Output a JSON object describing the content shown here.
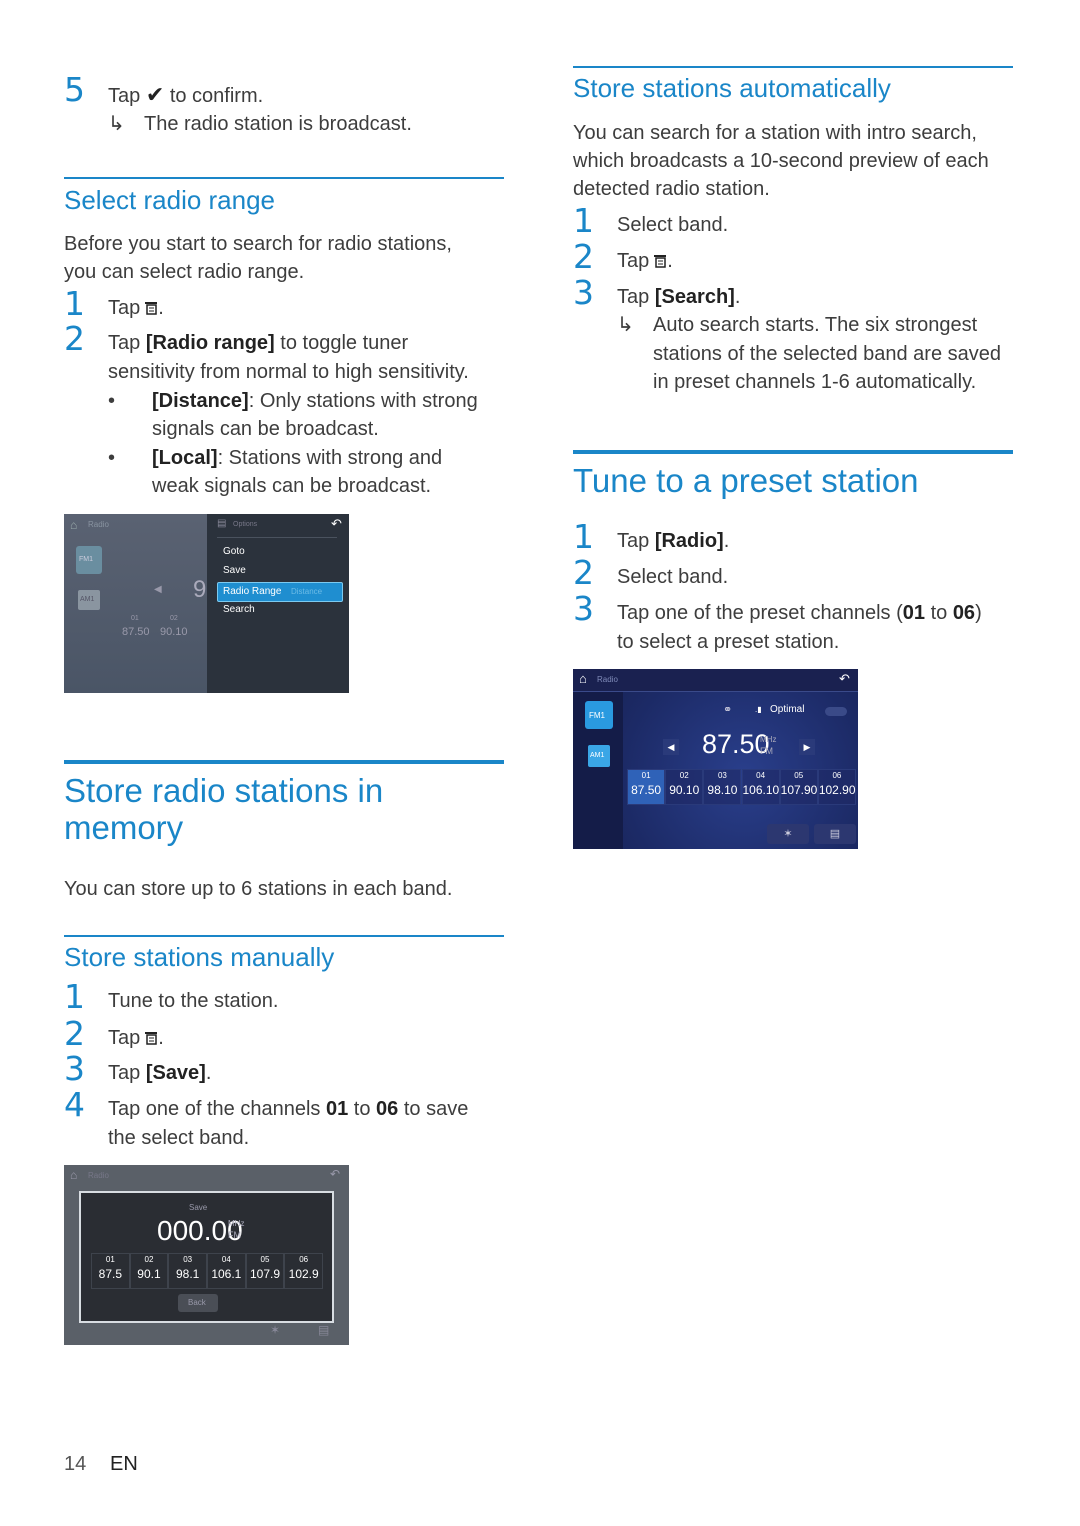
{
  "colors": {
    "accent": "#1a86c8",
    "text": "#3d3d3d"
  },
  "left": {
    "step5": {
      "num": "5",
      "tap": "Tap",
      "confirm": "to confirm.",
      "icon": "checkmark-icon",
      "result": "The radio station is broadcast."
    },
    "select_range": {
      "heading": "Select radio range",
      "intro": [
        "Before you start to search for radio stations,",
        "you can select radio range."
      ],
      "steps": [
        {
          "num": "1",
          "tap": "Tap",
          "end": ".",
          "icon": "menu-icon"
        },
        {
          "num": "2",
          "tap": "Tap",
          "bold": "[Radio range]",
          "rest": "to toggle tuner",
          "cont": "sensitivity from normal to high sensitivity."
        }
      ],
      "bullets": [
        {
          "bold": "[Distance]",
          "rest": ": Only stations with strong",
          "cont": "signals can be broadcast."
        },
        {
          "bold": "[Local]",
          "rest": ": Stations with strong and",
          "cont": "weak signals can be broadcast."
        }
      ],
      "screenshot": {
        "title": "Radio",
        "menu_title": "Options",
        "menu_items": [
          "Goto",
          "Save",
          "Radio Range",
          "Search"
        ],
        "selected_value": "Distance",
        "bands": [
          "FM1",
          "AM1"
        ],
        "presets": [
          {
            "n": "01",
            "v": "87.50"
          },
          {
            "n": "02",
            "v": "90.10"
          }
        ],
        "freq_partial": "9"
      }
    },
    "store_memory": {
      "heading_lines": [
        "Store radio stations in",
        "memory"
      ],
      "intro": "You can store up to 6 stations in each band."
    },
    "store_manual": {
      "heading": "Store stations manually",
      "steps": [
        {
          "num": "1",
          "text": "Tune to the station."
        },
        {
          "num": "2",
          "tap": "Tap",
          "end": ".",
          "icon": "menu-icon"
        },
        {
          "num": "3",
          "tap": "Tap",
          "bold": "[Save]",
          "end": "."
        },
        {
          "num": "4",
          "pre": "Tap one of the channels",
          "b1": "01",
          "mid": "to",
          "b2": "06",
          "post": "to save",
          "cont": "the select band."
        }
      ],
      "screenshot": {
        "title": "Radio",
        "dialog_title": "Save",
        "freq": "000.00",
        "unit": "MHz",
        "band": "FM",
        "presets": [
          {
            "n": "01",
            "v": "87.5"
          },
          {
            "n": "02",
            "v": "90.1"
          },
          {
            "n": "03",
            "v": "98.1"
          },
          {
            "n": "04",
            "v": "106.1"
          },
          {
            "n": "05",
            "v": "107.9"
          },
          {
            "n": "06",
            "v": "102.9"
          }
        ],
        "back": "Back"
      }
    }
  },
  "right": {
    "store_auto": {
      "heading": "Store stations automatically",
      "intro": [
        "You can search for a station with intro search,",
        "which broadcasts a 10-second preview of each",
        "detected radio station."
      ],
      "steps": [
        {
          "num": "1",
          "text": "Select band."
        },
        {
          "num": "2",
          "tap": "Tap",
          "end": ".",
          "icon": "menu-icon"
        },
        {
          "num": "3",
          "tap": "Tap",
          "bold": "[Search]",
          "end": "."
        }
      ],
      "result": [
        "Auto search starts. The six strongest",
        "stations of the selected band are saved",
        "in preset channels 1-6 automatically."
      ]
    },
    "tune_preset": {
      "heading": "Tune to a preset station",
      "steps": [
        {
          "num": "1",
          "tap": "Tap",
          "bold": "[Radio]",
          "end": "."
        },
        {
          "num": "2",
          "text": "Select band."
        },
        {
          "num": "3",
          "pre": "Tap one of the preset channels (",
          "b1": "01",
          "mid": "to",
          "b2": "06",
          "post": ")",
          "cont": "to select a preset station."
        }
      ],
      "screenshot": {
        "title": "Radio",
        "signal": "Optimal",
        "freq": "87.50",
        "unit": "MHz",
        "band": "FM",
        "bands": [
          "FM1",
          "AM1"
        ],
        "presets": [
          {
            "n": "01",
            "v": "87.50"
          },
          {
            "n": "02",
            "v": "90.10"
          },
          {
            "n": "03",
            "v": "98.10"
          },
          {
            "n": "04",
            "v": "106.10"
          },
          {
            "n": "05",
            "v": "107.90"
          },
          {
            "n": "06",
            "v": "102.90"
          }
        ],
        "selected_preset": "01"
      }
    }
  },
  "footer": {
    "page": "14",
    "lang": "EN"
  }
}
